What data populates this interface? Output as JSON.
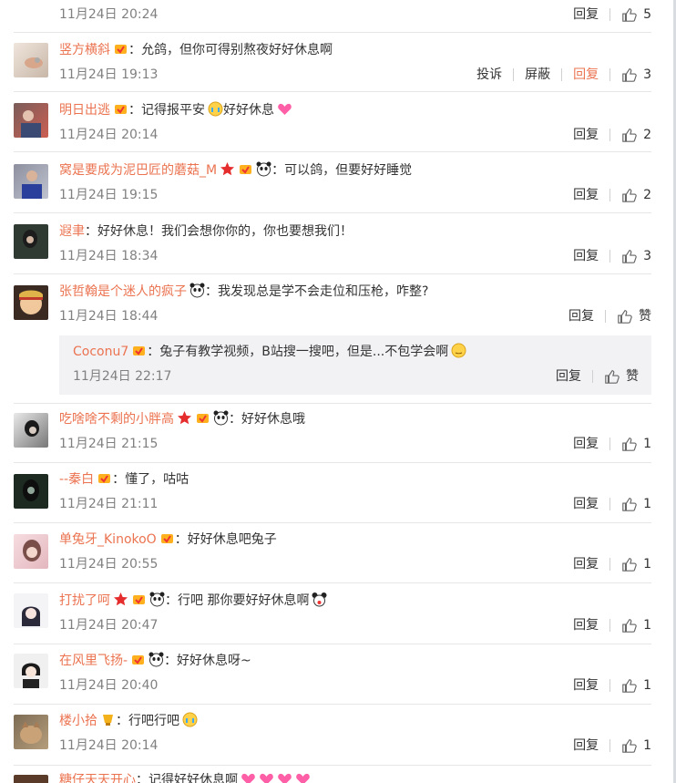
{
  "colors": {
    "username": "#eb7350",
    "text": "#333333",
    "meta": "#808080",
    "divider": "#e6e6e6",
    "reply_bg": "#f2f2f5"
  },
  "comments": [
    {
      "username": "",
      "text": "",
      "time": "11月24日 20:24",
      "actions": {
        "reply": "回复"
      },
      "like": "5"
    },
    {
      "username": "竖方横斜",
      "text": "：允鸽，但你可得别熬夜好好休息啊",
      "time": "11月24日 19:13",
      "actions": {
        "report": "投诉",
        "block": "屏蔽",
        "reply": "回复"
      },
      "like": "3"
    },
    {
      "username": "明日出逃",
      "text": "：记得报平安",
      "text2": "好好休息",
      "time": "11月24日 20:14",
      "actions": {
        "reply": "回复"
      },
      "like": "2"
    },
    {
      "username": "窝是要成为泥巴匠的蘑菇_M",
      "text": "：可以鸽，但要好好睡觉",
      "time": "11月24日 19:15",
      "actions": {
        "reply": "回复"
      },
      "like": "2"
    },
    {
      "username": "遐聿",
      "text": "：好好休息！我们会想你你的，你也要想我们！",
      "time": "11月24日 18:34",
      "actions": {
        "reply": "回复"
      },
      "like": "3"
    },
    {
      "username": "张哲翰是个迷人的疯子",
      "text": "：我发现总是学不会走位和压枪，咋整?",
      "time": "11月24日 18:44",
      "actions": {
        "reply": "回复"
      },
      "like": "赞",
      "sub": {
        "username": "Coconu7",
        "text": "：兔子有教学视频，B站搜一搜吧，但是...不包学会啊",
        "time": "11月24日 22:17",
        "reply": "回复",
        "like": "赞"
      }
    },
    {
      "username": "吃啥啥不剩的小胖高",
      "text": "：好好休息哦",
      "time": "11月24日 21:15",
      "actions": {
        "reply": "回复"
      },
      "like": "1"
    },
    {
      "username": "--秦白",
      "text": "：懂了，咕咕",
      "time": "11月24日 21:11",
      "actions": {
        "reply": "回复"
      },
      "like": "1"
    },
    {
      "username": "单兔牙_KinokoO",
      "text": "：好好休息吧兔子",
      "time": "11月24日 20:55",
      "actions": {
        "reply": "回复"
      },
      "like": "1"
    },
    {
      "username": "打扰了呵",
      "text": "：行吧 那你要好好休息啊",
      "time": "11月24日 20:47",
      "actions": {
        "reply": "回复"
      },
      "like": "1"
    },
    {
      "username": "在风里飞扬-",
      "text": "：好好休息呀~",
      "time": "11月24日 20:40",
      "actions": {
        "reply": "回复"
      },
      "like": "1"
    },
    {
      "username": "楼小拾",
      "text": "：行吧行吧",
      "time": "11月24日 20:14",
      "actions": {
        "reply": "回复"
      },
      "like": "1"
    },
    {
      "username": "糖仔天天开心",
      "text": "：记得好好休息啊",
      "time": "",
      "actions": {},
      "like": ""
    }
  ]
}
